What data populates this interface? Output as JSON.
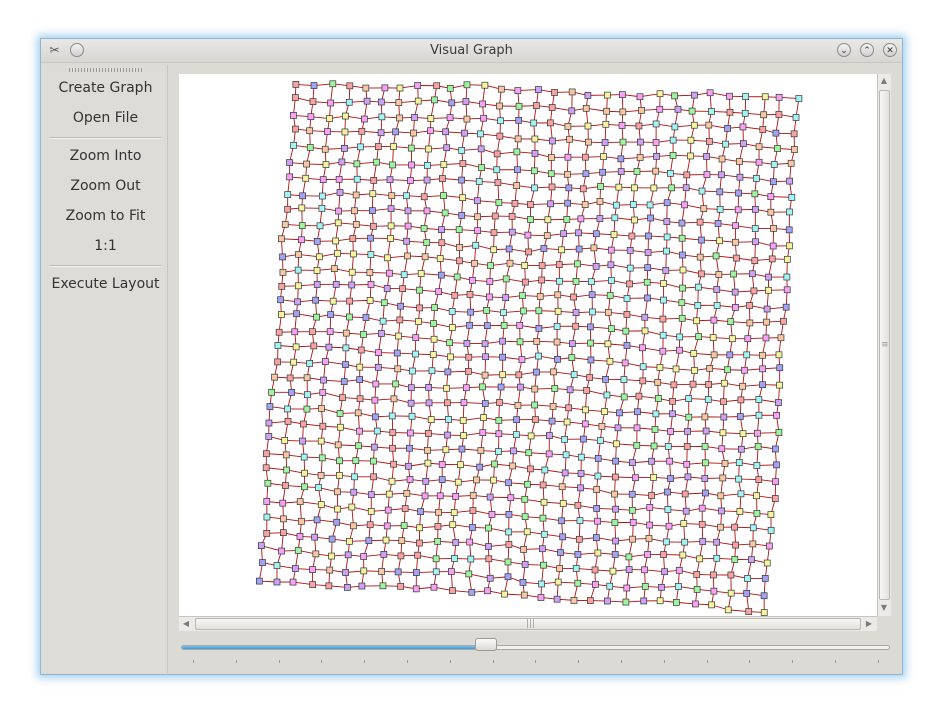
{
  "window": {
    "title": "Visual Graph",
    "app_icon": "tools-icon",
    "controls": [
      "minimize",
      "maximize",
      "close"
    ]
  },
  "sidebar": {
    "items": [
      {
        "label": "Create Graph"
      },
      {
        "label": "Open File"
      },
      {
        "label": "Zoom Into"
      },
      {
        "label": "Zoom Out"
      },
      {
        "label": "Zoom to Fit"
      },
      {
        "label": "1:1"
      },
      {
        "label": "Execute Layout"
      }
    ]
  },
  "graph": {
    "type": "grid",
    "node_colors": [
      "#f5a3a3",
      "#9ff59f",
      "#a3a3f5",
      "#f5f59f",
      "#f5a3f5",
      "#a3f5f5",
      "#f5c9a3",
      "#c9a3f5"
    ],
    "edge_color": "#b01010",
    "node_border_color": "#333333"
  },
  "zoom_slider": {
    "value": 0.43,
    "accent_color": "#3d98d4"
  }
}
